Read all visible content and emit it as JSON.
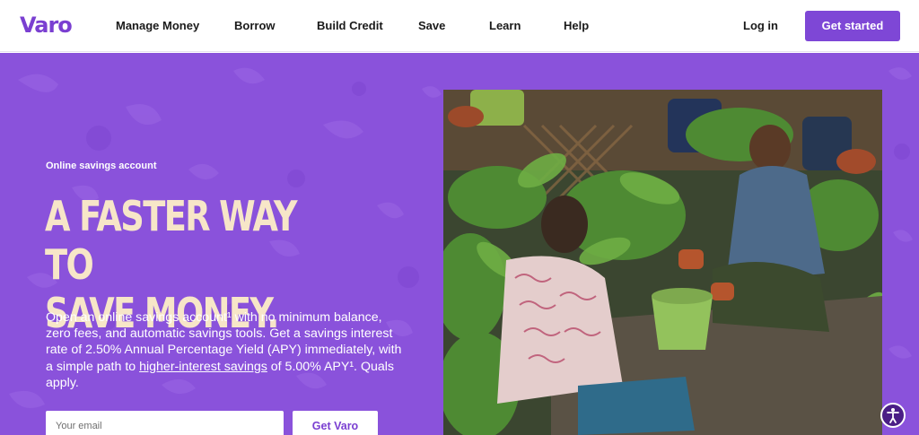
{
  "header": {
    "logo": "Varo",
    "nav": [
      "Manage Money",
      "Borrow",
      "Build Credit",
      "Save",
      "Learn",
      "Help"
    ],
    "login_label": "Log in",
    "cta_label": "Get started"
  },
  "hero": {
    "eyebrow": "Online savings account",
    "headline_line1": "A FASTER WAY TO",
    "headline_line2": "SAVE MONEY.",
    "body_part1": "Open an online savings account¹ with no minimum balance, zero fees, and automatic savings tools. Get a savings interest rate of 2.50% Annual Percentage Yield (APY) immediately, with a simple path to ",
    "body_link": "higher-interest savings",
    "body_part2": " of 5.00% APY¹. Quals apply.",
    "email_placeholder": "Your email",
    "submit_label": "Get Varo"
  },
  "colors": {
    "brand": "#7e47d6",
    "hero_bg": "#8a52db",
    "headline": "#f7e6c8"
  },
  "icons": {
    "accessibility": "accessibility-icon"
  }
}
